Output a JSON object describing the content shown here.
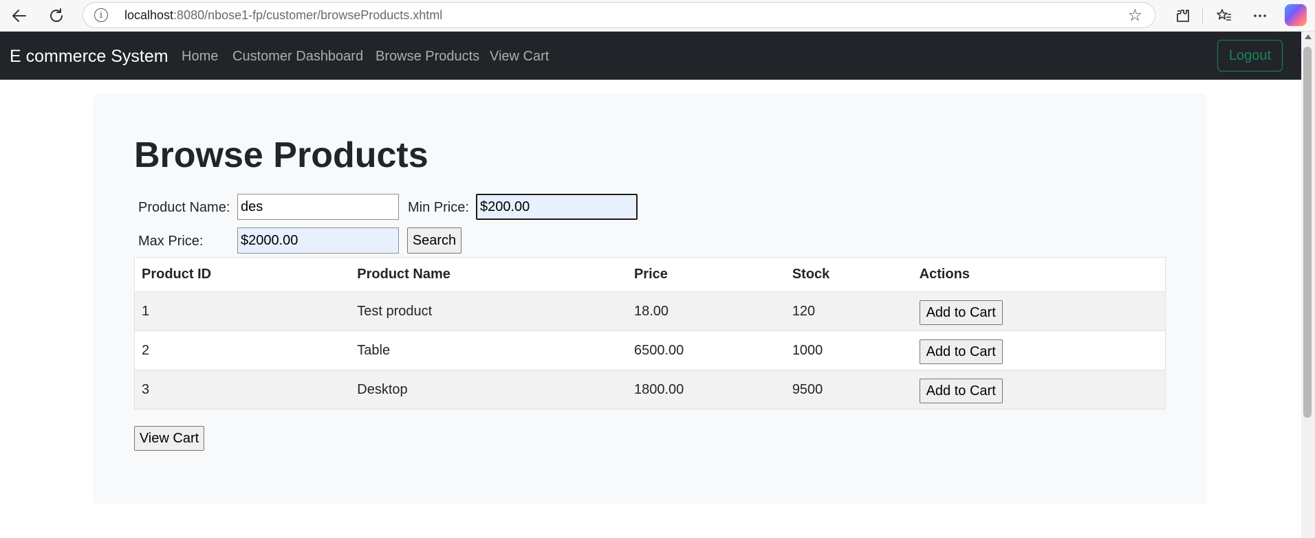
{
  "browser": {
    "url_host": "localhost",
    "url_rest": ":8080/nbose1-fp/customer/browseProducts.xhtml"
  },
  "navbar": {
    "brand": "E commerce System",
    "links": [
      "Home",
      "Customer Dashboard",
      "Browse Products",
      "View Cart"
    ],
    "logout": "Logout"
  },
  "page": {
    "title": "Browse Products"
  },
  "search": {
    "product_name_label": "Product Name:",
    "product_name_value": "des",
    "min_price_label": "Min Price:",
    "min_price_value": "$200.00",
    "max_price_label": "Max Price:",
    "max_price_value": "$2000.00",
    "search_button": "Search"
  },
  "table": {
    "headers": [
      "Product ID",
      "Product Name",
      "Price",
      "Stock",
      "Actions"
    ],
    "rows": [
      {
        "id": "1",
        "name": "Test product",
        "price": "18.00",
        "stock": "120",
        "action": "Add to Cart"
      },
      {
        "id": "2",
        "name": "Table",
        "price": "6500.00",
        "stock": "1000",
        "action": "Add to Cart"
      },
      {
        "id": "3",
        "name": "Desktop",
        "price": "1800.00",
        "stock": "9500",
        "action": "Add to Cart"
      }
    ]
  },
  "view_cart_button": "View Cart",
  "colors": {
    "navbar_bg": "#212529",
    "logout_accent": "#198754",
    "card_bg": "#f8f9fa",
    "autofill_bg": "#e8f0fe"
  }
}
